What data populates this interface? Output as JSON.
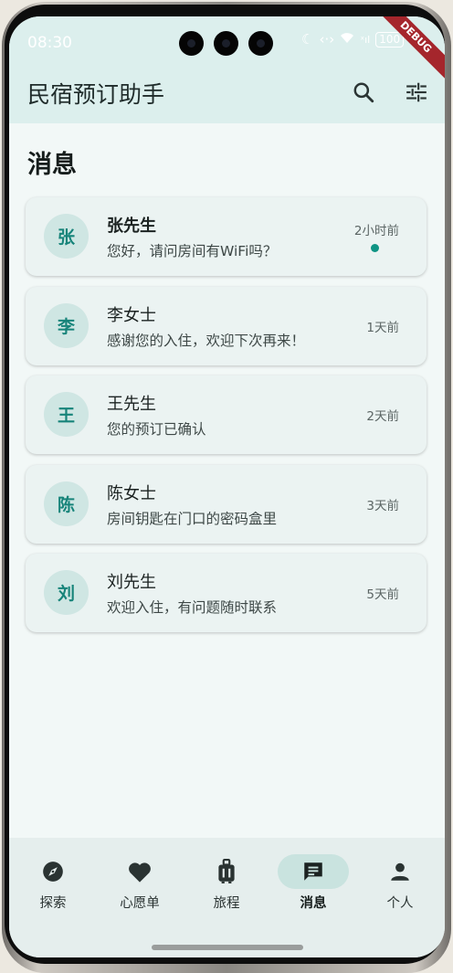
{
  "status_bar": {
    "time": "08:30",
    "battery": "100"
  },
  "debug_banner": "DEBUG",
  "app_bar": {
    "title": "民宿预订助手",
    "search_icon": "search-icon",
    "filter_icon": "tune-icon"
  },
  "page": {
    "title": "消息"
  },
  "messages": [
    {
      "avatar": "张",
      "name": "张先生",
      "preview": "您好，请问房间有WiFi吗？",
      "time": "2小时前",
      "unread": true
    },
    {
      "avatar": "李",
      "name": "李女士",
      "preview": "感谢您的入住，欢迎下次再来！",
      "time": "1天前",
      "unread": false
    },
    {
      "avatar": "王",
      "name": "王先生",
      "preview": "您的预订已确认",
      "time": "2天前",
      "unread": false
    },
    {
      "avatar": "陈",
      "name": "陈女士",
      "preview": "房间钥匙在门口的密码盒里",
      "time": "3天前",
      "unread": false
    },
    {
      "avatar": "刘",
      "name": "刘先生",
      "preview": "欢迎入住，有问题随时联系",
      "time": "5天前",
      "unread": false
    }
  ],
  "bottom_nav": [
    {
      "label": "探索",
      "icon": "compass-icon",
      "active": false
    },
    {
      "label": "心愿单",
      "icon": "heart-icon",
      "active": false
    },
    {
      "label": "旅程",
      "icon": "luggage-icon",
      "active": false
    },
    {
      "label": "消息",
      "icon": "chat-icon",
      "active": true
    },
    {
      "label": "个人",
      "icon": "person-icon",
      "active": false
    }
  ],
  "colors": {
    "accent": "#17847a",
    "unread_dot": "#0f9484",
    "app_bar_bg": "#dcefed",
    "page_bg": "#f2f8f7",
    "nav_active_pill": "#c9e3df"
  }
}
